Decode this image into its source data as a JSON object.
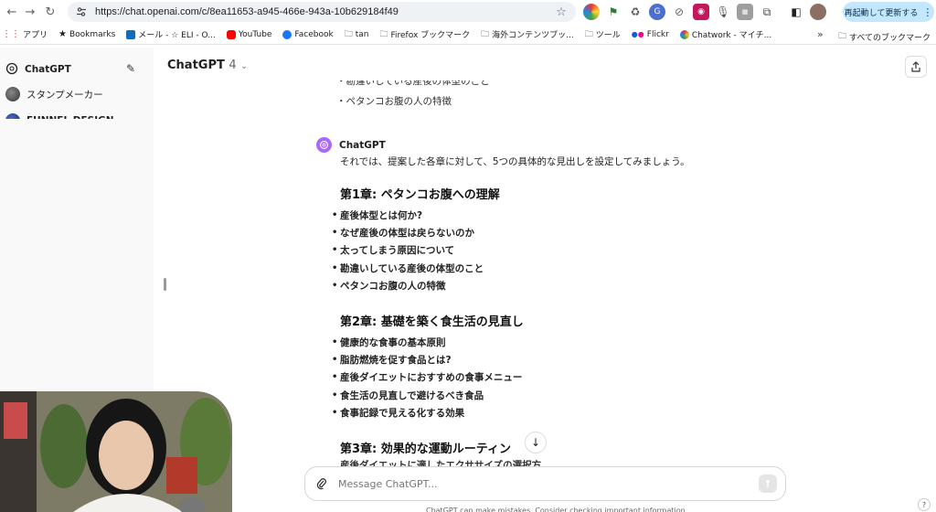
{
  "browser": {
    "url": "https://chat.openai.com/c/8ea11653-a945-466e-943a-10b629184f49",
    "relaunch_label": "再起動して更新する",
    "bookmarks": [
      {
        "label": "アプリ",
        "icon": "apps-grid-icon"
      },
      {
        "label": "Bookmarks",
        "icon": "star-icon"
      },
      {
        "label": "メール - ☆ ELI - O...",
        "icon": "outlook-icon"
      },
      {
        "label": "YouTube",
        "icon": "youtube-icon"
      },
      {
        "label": "Facebook",
        "icon": "facebook-icon"
      },
      {
        "label": "tan",
        "icon": "folder-icon"
      },
      {
        "label": "Firefox ブックマーク",
        "icon": "folder-icon"
      },
      {
        "label": "海外コンテンツブッ...",
        "icon": "folder-icon"
      },
      {
        "label": "ツール",
        "icon": "folder-icon"
      },
      {
        "label": "Flickr",
        "icon": "flickr-icon"
      },
      {
        "label": "Chatwork - マイチ...",
        "icon": "chatwork-icon"
      }
    ],
    "all_bookmarks_label": "すべてのブックマーク"
  },
  "sidebar": {
    "items": [
      {
        "label": "ChatGPT"
      },
      {
        "label": "スタンプメーカー"
      },
      {
        "label": "FUNNEL DESIGN"
      }
    ]
  },
  "header": {
    "model_name": "ChatGPT",
    "model_version": "4"
  },
  "conversation": {
    "previous_lines": [
      "・勘違いしている産後の体型のこと",
      "・ペタンコお腹の人の特徴"
    ],
    "assistant_name": "ChatGPT",
    "intro": "それでは、提案した各章に対して、5つの具体的な見出しを設定してみましょう。",
    "chapters": [
      {
        "title": "第1章: ペタンコお腹への理解",
        "items": [
          "産後体型とは何か?",
          "なぜ産後の体型は戻らないのか",
          "太ってしまう原因について",
          "勘違いしている産後の体型のこと",
          "ペタンコお腹の人の特徴"
        ]
      },
      {
        "title": "第2章: 基礎を築く食生活の見直し",
        "items": [
          "健康的な食事の基本原則",
          "脂肪燃焼を促す食品とは?",
          "産後ダイエットにおすすめの食事メニュー",
          "食生活の見直しで避けるべき食品",
          "食事記録で見える化する効果"
        ]
      },
      {
        "title": "第3章: 効果的な運動ルーティン",
        "items": []
      }
    ],
    "cut_off_line": "産後ダイエットに適したエクササイズの選択方"
  },
  "composer": {
    "placeholder": "Message ChatGPT...",
    "disclaimer": "ChatGPT can make mistakes. Consider checking important information."
  },
  "colors": {
    "accent_purple": "#ab68ff",
    "relaunch_bg": "#c2e7ff",
    "sidebar_bg": "#f9f9f9"
  }
}
